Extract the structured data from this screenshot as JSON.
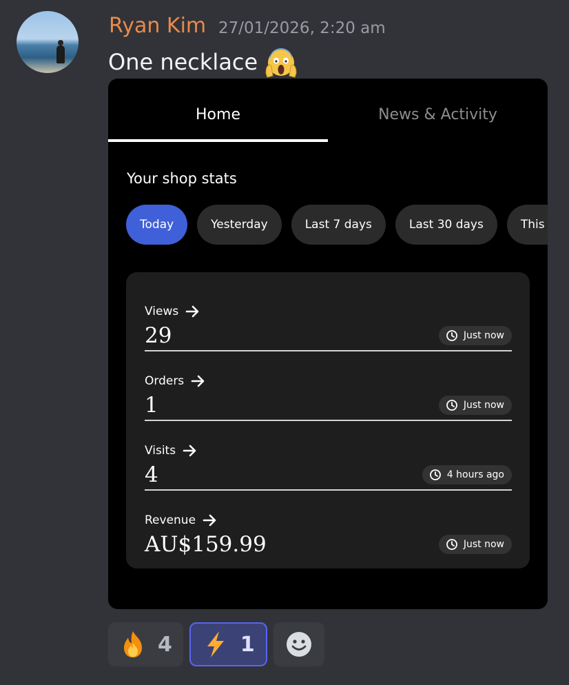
{
  "message": {
    "author": "Ryan Kim",
    "timestamp": "27/01/2026, 2:20 am",
    "text": "One necklace",
    "text_emoji": "face-screaming-in-fear-icon"
  },
  "embed": {
    "tabs": [
      {
        "label": "Home",
        "selected": true
      },
      {
        "label": "News & Activity",
        "selected": false
      }
    ],
    "section_title": "Your shop stats",
    "periods": [
      {
        "label": "Today",
        "selected": true
      },
      {
        "label": "Yesterday",
        "selected": false
      },
      {
        "label": "Last 7 days",
        "selected": false
      },
      {
        "label": "Last 30 days",
        "selected": false
      },
      {
        "label": "This r",
        "selected": false
      }
    ],
    "stats": [
      {
        "label": "Views",
        "value": "29",
        "updated": "Just now"
      },
      {
        "label": "Orders",
        "value": "1",
        "updated": "Just now"
      },
      {
        "label": "Visits",
        "value": "4",
        "updated": "4 hours ago"
      },
      {
        "label": "Revenue",
        "value": "AU$159.99",
        "updated": "Just now"
      }
    ]
  },
  "reactions": [
    {
      "emoji": "fire-icon",
      "count": "4",
      "selected": false
    },
    {
      "emoji": "lightning-icon",
      "count": "1",
      "selected": true
    }
  ],
  "add_reaction_icon": "add-reaction-icon",
  "colors": {
    "background": "#313338",
    "author": "#e98a4c",
    "active_chip": "#3f60d8",
    "selected_reaction_border": "#5865f2"
  }
}
